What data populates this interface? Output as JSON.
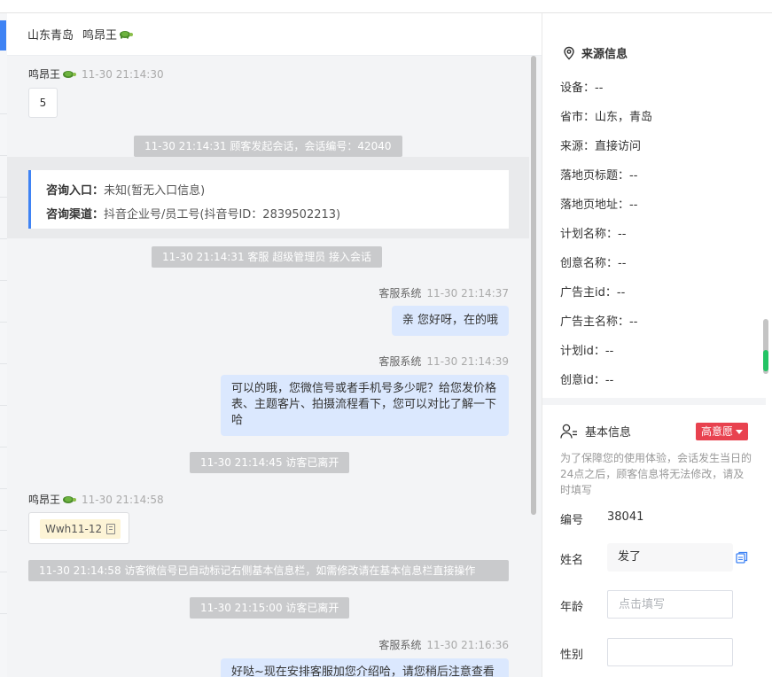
{
  "chat": {
    "header": {
      "location": "山东青岛",
      "name": "鸣昂王"
    },
    "messages": {
      "m1_sender": "鸣昂王",
      "m1_time": "11-30 21:14:30",
      "m1_text": "5",
      "sys1": "11-30 21:14:31 顾客发起会话，会话编号：42040",
      "consult_entry_label": "咨询入口：",
      "consult_entry_value": "未知(暂无入口信息)",
      "consult_channel_label": "咨询渠道：",
      "consult_channel_value": "抖音企业号/员工号(抖音号ID：2839502213)",
      "sys2": "11-30 21:14:31 客服 超级管理员 接入会话",
      "m2_sender": "客服系统",
      "m2_time": "11-30 21:14:37",
      "m2_text": "亲 您好呀，在的哦",
      "m3_sender": "客服系统",
      "m3_time": "11-30 21:14:39",
      "m3_text": "可以的哦，您微信号或者手机号多少呢？给您发价格表、主题客片、拍摄流程看下，您可以对比了解一下哈",
      "sys3": "11-30 21:14:45 访客已离开",
      "m4_sender": "鸣昂王",
      "m4_time": "11-30 21:14:58",
      "m4_text": "Wwh11-12",
      "sys4": "11-30 21:14:58 访客微信号已自动标记右侧基本信息栏，如需修改请在基本信息栏直接操作",
      "sys5": "11-30 21:15:00 访客已离开",
      "m5_sender": "客服系统",
      "m5_time": "11-30 21:16:36",
      "m5_text": "好哒~现在安排客服加您介绍哈，请您稍后注意查看"
    }
  },
  "panel": {
    "source_title": "来源信息",
    "source_rows": [
      {
        "label": "设备：",
        "value": "--"
      },
      {
        "label": "省市：",
        "value": "山东，青岛"
      },
      {
        "label": "来源：",
        "value": "直接访问"
      },
      {
        "label": "落地页标题：",
        "value": "--"
      },
      {
        "label": "落地页地址：",
        "value": "--"
      },
      {
        "label": "计划名称：",
        "value": "--"
      },
      {
        "label": "创意名称：",
        "value": "--"
      },
      {
        "label": "广告主id：",
        "value": "--"
      },
      {
        "label": "广告主名称：",
        "value": "--"
      },
      {
        "label": "计划id：",
        "value": "--"
      },
      {
        "label": "创意id：",
        "value": "--"
      }
    ],
    "basic_title": "基本信息",
    "intent_badge": "高意愿",
    "hint": "为了保障您的使用体验，会话发生当日的24点之后，顾客信息将无法修改，请及时填写",
    "id_label": "编号",
    "id_value": "38041",
    "name_label": "姓名",
    "name_value": "发了",
    "age_label": "年龄",
    "age_placeholder": "点击填写",
    "gender_label": "性别",
    "gender_value": ""
  },
  "colors": {
    "accent": "#3f83f4",
    "bubble_agent": "#dbe8fe",
    "system_msg": "#c9cacc",
    "badge": "#e8424f",
    "wechat_tag": "#fdf4d6"
  },
  "icons": [
    "turtle-emoji-icon",
    "location-pin-icon",
    "user-list-icon",
    "copy-icon",
    "caret-down-icon"
  ]
}
